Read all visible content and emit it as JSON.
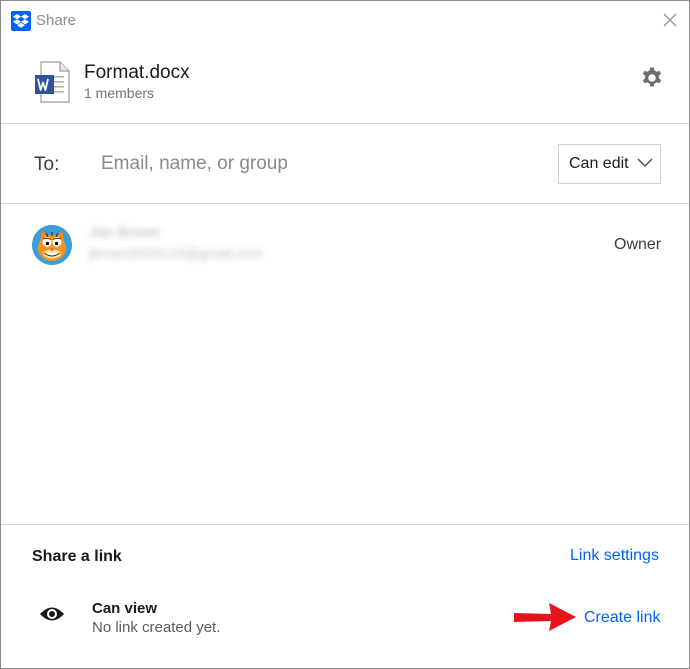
{
  "window": {
    "title": "Share",
    "icons": {
      "app": "dropbox-icon",
      "close": "close-icon"
    }
  },
  "file": {
    "name": "Format.docx",
    "members": "1 members",
    "icons": {
      "file": "word-document-icon",
      "settings": "gear-icon"
    }
  },
  "share_to": {
    "label": "To:",
    "placeholder": "Email, name, or group",
    "value": "",
    "permission": "Can edit",
    "icons": {
      "dropdown": "chevron-down-icon"
    }
  },
  "members": [
    {
      "name": "Jan Brown",
      "email": "jbrown2023123@gmail.com",
      "role": "Owner",
      "avatar": "garfield-avatar"
    }
  ],
  "share_link": {
    "title": "Share a link",
    "settings_label": "Link settings",
    "access_title": "Can view",
    "access_status": "No link created yet.",
    "create_label": "Create link",
    "icons": {
      "access": "eye-icon",
      "pointer": "red-arrow-icon"
    }
  },
  "colors": {
    "accent": "#0061fe",
    "divider": "#dcdcdc",
    "arrow": "#e8141c"
  }
}
